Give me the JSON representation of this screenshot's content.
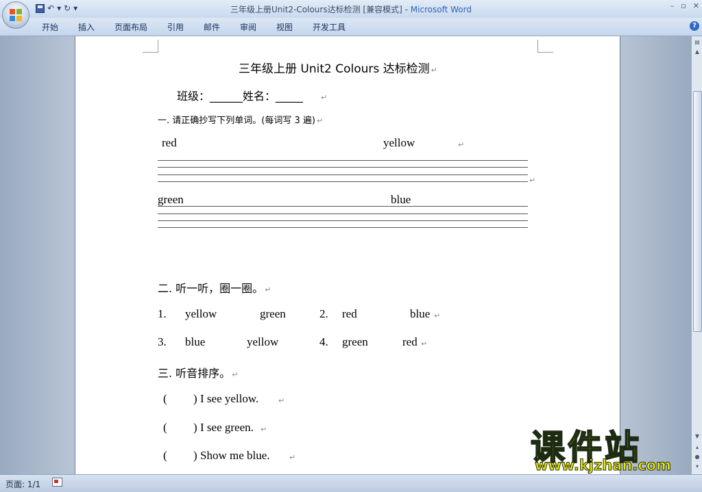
{
  "window": {
    "title": "三年级上册Unit2-Colours达标检测 [兼容模式] - ",
    "app_name": "Microsoft Word",
    "minimize": "–",
    "restore": "▫",
    "close": "✕"
  },
  "qat": {
    "undo": "↶",
    "redo": "↻",
    "more": "▾"
  },
  "ribbon_tabs": [
    "开始",
    "插入",
    "页面布局",
    "引用",
    "邮件",
    "审阅",
    "视图",
    "开发工具"
  ],
  "help": "?",
  "document": {
    "title": "三年级上册 Unit2 Colours 达标检测",
    "class_name_line": "班级：______姓名：_____",
    "section1": {
      "heading": "一. 请正确抄写下列单词。(每词写 3 遍)",
      "words_row1": [
        "red",
        "yellow"
      ],
      "words_row2": [
        "green",
        "blue"
      ]
    },
    "section2": {
      "heading": "二. 听一听，圈一圈。",
      "row1": [
        "1.",
        "yellow",
        "green",
        "2.",
        "red",
        "blue"
      ],
      "row2": [
        "3.",
        "blue",
        "yellow",
        "4.",
        "green",
        "red"
      ]
    },
    "section3": {
      "heading": "三. 听音排序。",
      "items": [
        {
          "bracket": "(",
          "close": ")",
          "text": "I see yellow."
        },
        {
          "bracket": "(",
          "close": ")",
          "text": "I see green."
        },
        {
          "bracket": "(",
          "close": ")",
          "text": "Show me blue."
        }
      ]
    },
    "paragraph_mark": "↵"
  },
  "status_bar": {
    "page": "页面: 1/1"
  },
  "watermark": {
    "title": "课件站",
    "url": "www.kjzhan.com"
  },
  "colors": {
    "title_app": "#2b62b8",
    "watermark_yellow": "#e8e60a"
  }
}
